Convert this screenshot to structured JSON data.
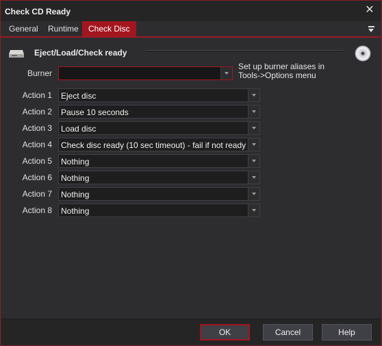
{
  "window": {
    "title": "Check CD Ready",
    "close_glyph": "✕"
  },
  "tabs": [
    {
      "label": "General"
    },
    {
      "label": "Runtime"
    },
    {
      "label": "Check Disc"
    }
  ],
  "section": {
    "title": "Eject/Load/Check ready",
    "icon": "cd-drive-icon",
    "disc_icon": "disc-icon"
  },
  "burner": {
    "label": "Burner",
    "value": "",
    "hint": "Set up burner aliases in Tools->Options menu"
  },
  "actions": [
    {
      "label": "Action 1",
      "value": "Eject disc"
    },
    {
      "label": "Action 2",
      "value": "Pause 10 seconds"
    },
    {
      "label": "Action 3",
      "value": "Load disc"
    },
    {
      "label": "Action 4",
      "value": "Check disc ready (10 sec timeout) - fail if not ready"
    },
    {
      "label": "Action 5",
      "value": "Nothing"
    },
    {
      "label": "Action 6",
      "value": "Nothing"
    },
    {
      "label": "Action 7",
      "value": "Nothing"
    },
    {
      "label": "Action 8",
      "value": "Nothing"
    }
  ],
  "buttons": {
    "ok": "OK",
    "cancel": "Cancel",
    "help": "Help"
  },
  "colors": {
    "accent": "#a3161f",
    "background": "#2d2d30",
    "field": "#1e1e1e"
  }
}
